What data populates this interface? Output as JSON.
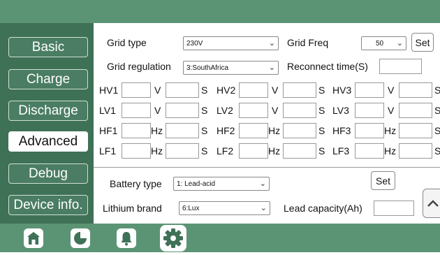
{
  "sidebar": {
    "items": [
      {
        "label": "Basic"
      },
      {
        "label": "Charge"
      },
      {
        "label": "Discharge"
      },
      {
        "label": "Advanced"
      },
      {
        "label": "Debug"
      },
      {
        "label": "Device info."
      }
    ]
  },
  "grid": {
    "grid_type_label": "Grid type",
    "grid_type_value": "230V",
    "grid_freq_label": "Grid Freq",
    "grid_freq_value": "50",
    "set_label": "Set",
    "grid_regulation_label": "Grid regulation",
    "grid_regulation_value": "3:SouthAfrica",
    "reconnect_label": "Reconnect time(S)"
  },
  "protection": {
    "rows": [
      {
        "groups": [
          {
            "name": "HV1",
            "unit": "V",
            "time_unit": "S"
          },
          {
            "name": "HV2",
            "unit": "V",
            "time_unit": "S"
          },
          {
            "name": "HV3",
            "unit": "V",
            "time_unit": "S"
          }
        ]
      },
      {
        "groups": [
          {
            "name": "LV1",
            "unit": "V",
            "time_unit": "S"
          },
          {
            "name": "LV2",
            "unit": "V",
            "time_unit": "S"
          },
          {
            "name": "LV3",
            "unit": "V",
            "time_unit": "S"
          }
        ]
      },
      {
        "groups": [
          {
            "name": "HF1",
            "unit": "Hz",
            "time_unit": "S"
          },
          {
            "name": "HF2",
            "unit": "Hz",
            "time_unit": "S"
          },
          {
            "name": "HF3",
            "unit": "Hz",
            "time_unit": "S"
          }
        ]
      },
      {
        "groups": [
          {
            "name": "LF1",
            "unit": "Hz",
            "time_unit": "S"
          },
          {
            "name": "LF2",
            "unit": "Hz",
            "time_unit": "S"
          },
          {
            "name": "LF3",
            "unit": "Hz",
            "time_unit": "S"
          }
        ]
      }
    ]
  },
  "battery": {
    "battery_type_label": "Battery type",
    "battery_type_value": "1: Lead-acid",
    "set_label": "Set",
    "lithium_brand_label": "Lithium brand",
    "lithium_brand_value": "6:Lux",
    "lead_capacity_label": "Lead capacity(Ah)"
  },
  "bottom_tabs": [
    {
      "icon": "home-icon"
    },
    {
      "icon": "pie-chart-icon"
    },
    {
      "icon": "bell-icon"
    },
    {
      "icon": "gear-icon"
    }
  ],
  "colors": {
    "bar_green": "#5b9474",
    "sidebar_green": "#3f7157"
  }
}
